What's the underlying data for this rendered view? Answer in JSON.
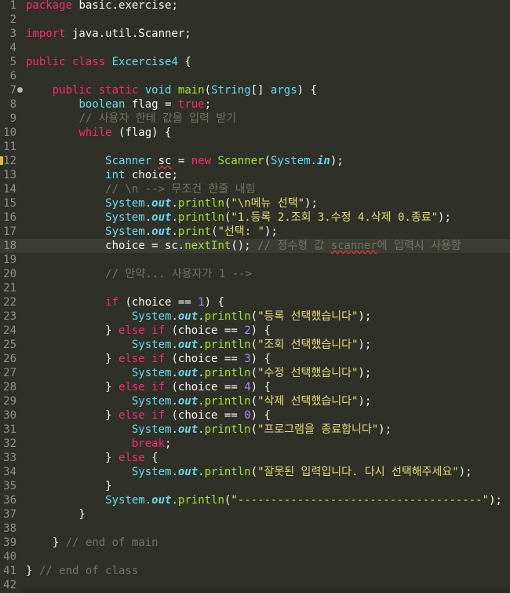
{
  "editor": {
    "current_line": 18,
    "colors": {
      "background": "#2f3129",
      "keyword": "#f92672",
      "type": "#66d9ef",
      "string": "#e6db74",
      "comment": "#75715e",
      "number": "#ae81ff",
      "method": "#a6e22e",
      "plain": "#f8f8f2",
      "line_number": "#8f908a"
    },
    "markers": [
      {
        "line": 7,
        "icon": "fold-collapse-icon"
      },
      {
        "line": 12,
        "icon": "warning-icon"
      }
    ],
    "lines": [
      {
        "n": "1",
        "t": [
          {
            "c": "k",
            "s": "package"
          },
          {
            "c": "p",
            "s": " basic.exercise;"
          }
        ]
      },
      {
        "n": "2",
        "t": []
      },
      {
        "n": "3",
        "t": [
          {
            "c": "k",
            "s": "import"
          },
          {
            "c": "p",
            "s": " java.util.Scanner;"
          }
        ]
      },
      {
        "n": "4",
        "t": []
      },
      {
        "n": "5",
        "t": [
          {
            "c": "k",
            "s": "public class"
          },
          {
            "c": "p",
            "s": " "
          },
          {
            "c": "t",
            "s": "Excercise4"
          },
          {
            "c": "p",
            "s": " {"
          }
        ]
      },
      {
        "n": "6",
        "t": []
      },
      {
        "n": "7",
        "t": [
          {
            "c": "p",
            "s": "    "
          },
          {
            "c": "k",
            "s": "public static"
          },
          {
            "c": "p",
            "s": " "
          },
          {
            "c": "t",
            "s": "void"
          },
          {
            "c": "p",
            "s": " "
          },
          {
            "c": "m",
            "s": "main"
          },
          {
            "c": "p",
            "s": "("
          },
          {
            "c": "t",
            "s": "String"
          },
          {
            "c": "p",
            "s": "[] "
          },
          {
            "c": "t",
            "s": "args"
          },
          {
            "c": "p",
            "s": ") {"
          }
        ]
      },
      {
        "n": "8",
        "t": [
          {
            "c": "p",
            "s": "        "
          },
          {
            "c": "t",
            "s": "boolean"
          },
          {
            "c": "p",
            "s": " flag = "
          },
          {
            "c": "k",
            "s": "true"
          },
          {
            "c": "p",
            "s": ";"
          }
        ]
      },
      {
        "n": "9",
        "t": [
          {
            "c": "p",
            "s": "        "
          },
          {
            "c": "c",
            "s": "// 사용자 한테 값을 입력 받기"
          }
        ]
      },
      {
        "n": "10",
        "t": [
          {
            "c": "p",
            "s": "        "
          },
          {
            "c": "k",
            "s": "while"
          },
          {
            "c": "p",
            "s": " (flag) {"
          }
        ]
      },
      {
        "n": "11",
        "t": []
      },
      {
        "n": "12",
        "t": [
          {
            "c": "p",
            "s": "            "
          },
          {
            "c": "t",
            "s": "Scanner"
          },
          {
            "c": "p",
            "s": " "
          },
          {
            "c": "p",
            "s": "sc",
            "u": true
          },
          {
            "c": "p",
            "s": " = "
          },
          {
            "c": "k",
            "s": "new"
          },
          {
            "c": "p",
            "s": " "
          },
          {
            "c": "m",
            "s": "Scanner"
          },
          {
            "c": "p",
            "s": "("
          },
          {
            "c": "t",
            "s": "System"
          },
          {
            "c": "p",
            "s": "."
          },
          {
            "c": "f",
            "s": "in"
          },
          {
            "c": "p",
            "s": ");"
          }
        ]
      },
      {
        "n": "13",
        "t": [
          {
            "c": "p",
            "s": "            "
          },
          {
            "c": "t",
            "s": "int"
          },
          {
            "c": "p",
            "s": " choice;"
          }
        ]
      },
      {
        "n": "14",
        "t": [
          {
            "c": "p",
            "s": "            "
          },
          {
            "c": "c",
            "s": "// \\n --> 무조건 한줄 내림"
          }
        ]
      },
      {
        "n": "15",
        "t": [
          {
            "c": "p",
            "s": "            "
          },
          {
            "c": "t",
            "s": "System"
          },
          {
            "c": "p",
            "s": "."
          },
          {
            "c": "f",
            "s": "out"
          },
          {
            "c": "p",
            "s": "."
          },
          {
            "c": "m",
            "s": "println"
          },
          {
            "c": "p",
            "s": "("
          },
          {
            "c": "s",
            "s": "\"\\n메뉴 선택\""
          },
          {
            "c": "p",
            "s": ");"
          }
        ]
      },
      {
        "n": "16",
        "t": [
          {
            "c": "p",
            "s": "            "
          },
          {
            "c": "t",
            "s": "System"
          },
          {
            "c": "p",
            "s": "."
          },
          {
            "c": "f",
            "s": "out"
          },
          {
            "c": "p",
            "s": "."
          },
          {
            "c": "m",
            "s": "println"
          },
          {
            "c": "p",
            "s": "("
          },
          {
            "c": "s",
            "s": "\"1.등록 2.조회 3.수정 4.삭제 0.종료\""
          },
          {
            "c": "p",
            "s": ");"
          }
        ]
      },
      {
        "n": "17",
        "t": [
          {
            "c": "p",
            "s": "            "
          },
          {
            "c": "t",
            "s": "System"
          },
          {
            "c": "p",
            "s": "."
          },
          {
            "c": "f",
            "s": "out"
          },
          {
            "c": "p",
            "s": "."
          },
          {
            "c": "m",
            "s": "print"
          },
          {
            "c": "p",
            "s": "("
          },
          {
            "c": "s",
            "s": "\"선택: \""
          },
          {
            "c": "p",
            "s": ");"
          }
        ]
      },
      {
        "n": "18",
        "t": [
          {
            "c": "p",
            "s": "            choice = sc."
          },
          {
            "c": "m",
            "s": "nextInt"
          },
          {
            "c": "p",
            "s": "(); "
          },
          {
            "c": "c",
            "s": "// 정수형 값 "
          },
          {
            "c": "c",
            "s": "scanner",
            "u": true
          },
          {
            "c": "c",
            "s": "에 입력시 사용함"
          }
        ]
      },
      {
        "n": "19",
        "t": []
      },
      {
        "n": "20",
        "t": [
          {
            "c": "p",
            "s": "            "
          },
          {
            "c": "c",
            "s": "// 만약... 사용자가 1 -->"
          }
        ]
      },
      {
        "n": "21",
        "t": []
      },
      {
        "n": "22",
        "t": [
          {
            "c": "p",
            "s": "            "
          },
          {
            "c": "k",
            "s": "if"
          },
          {
            "c": "p",
            "s": " (choice == "
          },
          {
            "c": "n",
            "s": "1"
          },
          {
            "c": "p",
            "s": ") {"
          }
        ]
      },
      {
        "n": "23",
        "t": [
          {
            "c": "p",
            "s": "                "
          },
          {
            "c": "t",
            "s": "System"
          },
          {
            "c": "p",
            "s": "."
          },
          {
            "c": "f",
            "s": "out"
          },
          {
            "c": "p",
            "s": "."
          },
          {
            "c": "m",
            "s": "println"
          },
          {
            "c": "p",
            "s": "("
          },
          {
            "c": "s",
            "s": "\"등록 선택했습니다\""
          },
          {
            "c": "p",
            "s": ");"
          }
        ]
      },
      {
        "n": "24",
        "t": [
          {
            "c": "p",
            "s": "            } "
          },
          {
            "c": "k",
            "s": "else if"
          },
          {
            "c": "p",
            "s": " (choice == "
          },
          {
            "c": "n",
            "s": "2"
          },
          {
            "c": "p",
            "s": ") {"
          }
        ]
      },
      {
        "n": "25",
        "t": [
          {
            "c": "p",
            "s": "                "
          },
          {
            "c": "t",
            "s": "System"
          },
          {
            "c": "p",
            "s": "."
          },
          {
            "c": "f",
            "s": "out"
          },
          {
            "c": "p",
            "s": "."
          },
          {
            "c": "m",
            "s": "println"
          },
          {
            "c": "p",
            "s": "("
          },
          {
            "c": "s",
            "s": "\"조회 선택했습니다\""
          },
          {
            "c": "p",
            "s": ");"
          }
        ]
      },
      {
        "n": "26",
        "t": [
          {
            "c": "p",
            "s": "            } "
          },
          {
            "c": "k",
            "s": "else if"
          },
          {
            "c": "p",
            "s": " (choice == "
          },
          {
            "c": "n",
            "s": "3"
          },
          {
            "c": "p",
            "s": ") {"
          }
        ]
      },
      {
        "n": "27",
        "t": [
          {
            "c": "p",
            "s": "                "
          },
          {
            "c": "t",
            "s": "System"
          },
          {
            "c": "p",
            "s": "."
          },
          {
            "c": "f",
            "s": "out"
          },
          {
            "c": "p",
            "s": "."
          },
          {
            "c": "m",
            "s": "println"
          },
          {
            "c": "p",
            "s": "("
          },
          {
            "c": "s",
            "s": "\"수정 선택했습니다\""
          },
          {
            "c": "p",
            "s": ");"
          }
        ]
      },
      {
        "n": "28",
        "t": [
          {
            "c": "p",
            "s": "            } "
          },
          {
            "c": "k",
            "s": "else if"
          },
          {
            "c": "p",
            "s": " (choice == "
          },
          {
            "c": "n",
            "s": "4"
          },
          {
            "c": "p",
            "s": ") {"
          }
        ]
      },
      {
        "n": "29",
        "t": [
          {
            "c": "p",
            "s": "                "
          },
          {
            "c": "t",
            "s": "System"
          },
          {
            "c": "p",
            "s": "."
          },
          {
            "c": "f",
            "s": "out"
          },
          {
            "c": "p",
            "s": "."
          },
          {
            "c": "m",
            "s": "println"
          },
          {
            "c": "p",
            "s": "("
          },
          {
            "c": "s",
            "s": "\"삭제 선택했습니다\""
          },
          {
            "c": "p",
            "s": ");"
          }
        ]
      },
      {
        "n": "30",
        "t": [
          {
            "c": "p",
            "s": "            } "
          },
          {
            "c": "k",
            "s": "else if"
          },
          {
            "c": "p",
            "s": " (choice == "
          },
          {
            "c": "n",
            "s": "0"
          },
          {
            "c": "p",
            "s": ") {"
          }
        ]
      },
      {
        "n": "31",
        "t": [
          {
            "c": "p",
            "s": "                "
          },
          {
            "c": "t",
            "s": "System"
          },
          {
            "c": "p",
            "s": "."
          },
          {
            "c": "f",
            "s": "out"
          },
          {
            "c": "p",
            "s": "."
          },
          {
            "c": "m",
            "s": "println"
          },
          {
            "c": "p",
            "s": "("
          },
          {
            "c": "s",
            "s": "\"프로그램을 종료합니다\""
          },
          {
            "c": "p",
            "s": ");"
          }
        ]
      },
      {
        "n": "32",
        "t": [
          {
            "c": "p",
            "s": "                "
          },
          {
            "c": "k",
            "s": "break"
          },
          {
            "c": "p",
            "s": ";"
          }
        ]
      },
      {
        "n": "33",
        "t": [
          {
            "c": "p",
            "s": "            } "
          },
          {
            "c": "k",
            "s": "else"
          },
          {
            "c": "p",
            "s": " {"
          }
        ]
      },
      {
        "n": "34",
        "t": [
          {
            "c": "p",
            "s": "                "
          },
          {
            "c": "t",
            "s": "System"
          },
          {
            "c": "p",
            "s": "."
          },
          {
            "c": "f",
            "s": "out"
          },
          {
            "c": "p",
            "s": "."
          },
          {
            "c": "m",
            "s": "println"
          },
          {
            "c": "p",
            "s": "("
          },
          {
            "c": "s",
            "s": "\"잘못된 입력입니다. 다시 선택해주세요\""
          },
          {
            "c": "p",
            "s": ");"
          }
        ]
      },
      {
        "n": "35",
        "t": [
          {
            "c": "p",
            "s": "            }"
          }
        ]
      },
      {
        "n": "36",
        "t": [
          {
            "c": "p",
            "s": "            "
          },
          {
            "c": "t",
            "s": "System"
          },
          {
            "c": "p",
            "s": "."
          },
          {
            "c": "f",
            "s": "out"
          },
          {
            "c": "p",
            "s": "."
          },
          {
            "c": "m",
            "s": "println"
          },
          {
            "c": "p",
            "s": "("
          },
          {
            "c": "s",
            "s": "\"-------------------------------------\""
          },
          {
            "c": "p",
            "s": ");"
          }
        ]
      },
      {
        "n": "37",
        "t": [
          {
            "c": "p",
            "s": "        }"
          }
        ]
      },
      {
        "n": "38",
        "t": []
      },
      {
        "n": "39",
        "t": [
          {
            "c": "p",
            "s": "    } "
          },
          {
            "c": "c",
            "s": "// end of main"
          }
        ]
      },
      {
        "n": "40",
        "t": []
      },
      {
        "n": "41",
        "t": [
          {
            "c": "p",
            "s": "} "
          },
          {
            "c": "c",
            "s": "// end of class"
          }
        ]
      },
      {
        "n": "42",
        "t": []
      }
    ]
  }
}
